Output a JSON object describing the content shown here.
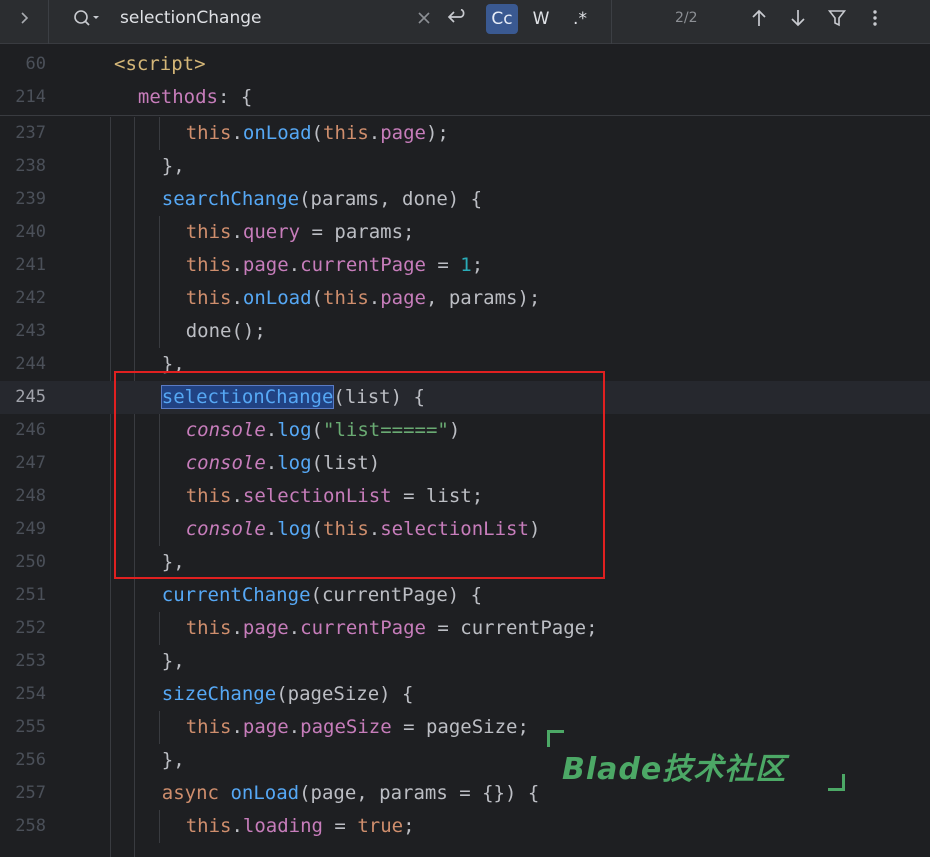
{
  "search": {
    "query": "selectionChange",
    "match_case_label": "Cc",
    "words_label": "W",
    "regex_label": ".*",
    "result_count": "2/2"
  },
  "editor": {
    "sticky": [
      {
        "num": "60",
        "tokens": [
          [
            "tag",
            "<script>"
          ]
        ]
      },
      {
        "num": "214",
        "tokens": [
          [
            "prop",
            "methods"
          ],
          [
            "",
            ": {"
          ]
        ]
      }
    ],
    "lines": [
      {
        "num": "237",
        "tokens": [
          [
            "kw",
            "this"
          ],
          [
            "",
            "."
          ],
          [
            "fn",
            "onLoad"
          ],
          [
            "",
            "("
          ],
          [
            "kw",
            "this"
          ],
          [
            "",
            "."
          ],
          [
            "prop",
            "page"
          ],
          [
            "",
            ");"
          ]
        ]
      },
      {
        "num": "238",
        "tokens": [
          [
            "",
            "},"
          ]
        ]
      },
      {
        "num": "239",
        "tokens": [
          [
            "fn",
            "searchChange"
          ],
          [
            "",
            "(params, done) {"
          ]
        ]
      },
      {
        "num": "240",
        "tokens": [
          [
            "kw",
            "this"
          ],
          [
            "",
            "."
          ],
          [
            "prop",
            "query"
          ],
          [
            "",
            " = params;"
          ]
        ]
      },
      {
        "num": "241",
        "tokens": [
          [
            "kw",
            "this"
          ],
          [
            "",
            "."
          ],
          [
            "prop",
            "page"
          ],
          [
            "",
            "."
          ],
          [
            "prop",
            "currentPage"
          ],
          [
            "",
            " = "
          ],
          [
            "num",
            "1"
          ],
          [
            "",
            ";"
          ]
        ]
      },
      {
        "num": "242",
        "tokens": [
          [
            "kw",
            "this"
          ],
          [
            "",
            "."
          ],
          [
            "fn",
            "onLoad"
          ],
          [
            "",
            "("
          ],
          [
            "kw",
            "this"
          ],
          [
            "",
            "."
          ],
          [
            "prop",
            "page"
          ],
          [
            "",
            ", params);"
          ]
        ]
      },
      {
        "num": "243",
        "tokens": [
          [
            "",
            "done();"
          ]
        ]
      },
      {
        "num": "244",
        "tokens": [
          [
            "",
            "},"
          ]
        ]
      },
      {
        "num": "245",
        "current": true,
        "tokens": [
          [
            "hl",
            "selectionChange"
          ],
          [
            "",
            "(list) {"
          ]
        ]
      },
      {
        "num": "246",
        "tokens": [
          [
            "con",
            "console"
          ],
          [
            "",
            "."
          ],
          [
            "fn",
            "log"
          ],
          [
            "",
            "("
          ],
          [
            "str",
            "\"list=====\""
          ],
          [
            "",
            ")"
          ]
        ]
      },
      {
        "num": "247",
        "tokens": [
          [
            "con",
            "console"
          ],
          [
            "",
            "."
          ],
          [
            "fn",
            "log"
          ],
          [
            "",
            "(list)"
          ]
        ]
      },
      {
        "num": "248",
        "tokens": [
          [
            "kw",
            "this"
          ],
          [
            "",
            "."
          ],
          [
            "prop",
            "selectionList"
          ],
          [
            "",
            " = list;"
          ]
        ]
      },
      {
        "num": "249",
        "tokens": [
          [
            "con",
            "console"
          ],
          [
            "",
            "."
          ],
          [
            "fn",
            "log"
          ],
          [
            "",
            "("
          ],
          [
            "kw",
            "this"
          ],
          [
            "",
            "."
          ],
          [
            "prop",
            "selectionList"
          ],
          [
            "",
            ")"
          ]
        ]
      },
      {
        "num": "250",
        "tokens": [
          [
            "",
            "},"
          ]
        ]
      },
      {
        "num": "251",
        "tokens": [
          [
            "fn",
            "currentChange"
          ],
          [
            "",
            "(currentPage) {"
          ]
        ]
      },
      {
        "num": "252",
        "tokens": [
          [
            "kw",
            "this"
          ],
          [
            "",
            "."
          ],
          [
            "prop",
            "page"
          ],
          [
            "",
            "."
          ],
          [
            "prop",
            "currentPage"
          ],
          [
            "",
            " = currentPage;"
          ]
        ]
      },
      {
        "num": "253",
        "tokens": [
          [
            "",
            "},"
          ]
        ]
      },
      {
        "num": "254",
        "tokens": [
          [
            "fn",
            "sizeChange"
          ],
          [
            "",
            "(pageSize) {"
          ]
        ]
      },
      {
        "num": "255",
        "tokens": [
          [
            "kw",
            "this"
          ],
          [
            "",
            "."
          ],
          [
            "prop",
            "page"
          ],
          [
            "",
            "."
          ],
          [
            "prop",
            "pageSize"
          ],
          [
            "",
            " = pageSize;"
          ]
        ]
      },
      {
        "num": "256",
        "tokens": [
          [
            "",
            "},"
          ]
        ]
      },
      {
        "num": "257",
        "tokens": [
          [
            "kw",
            "async "
          ],
          [
            "fn",
            "onLoad"
          ],
          [
            "",
            "(page, params = {}) {"
          ]
        ]
      },
      {
        "num": "258",
        "tokens": [
          [
            "kw",
            "this"
          ],
          [
            "",
            "."
          ],
          [
            "prop",
            "loading"
          ],
          [
            "",
            " = "
          ],
          [
            "kw",
            "true"
          ],
          [
            "",
            ";"
          ]
        ]
      }
    ]
  },
  "watermark": "Blade技术社区",
  "colors": {
    "background": "#1e1f22",
    "keyword": "#cf8e6d",
    "function": "#56a8f5",
    "property": "#c77dbb",
    "string": "#6aab73",
    "number": "#2aacb8",
    "annotation_box": "#e02020"
  }
}
